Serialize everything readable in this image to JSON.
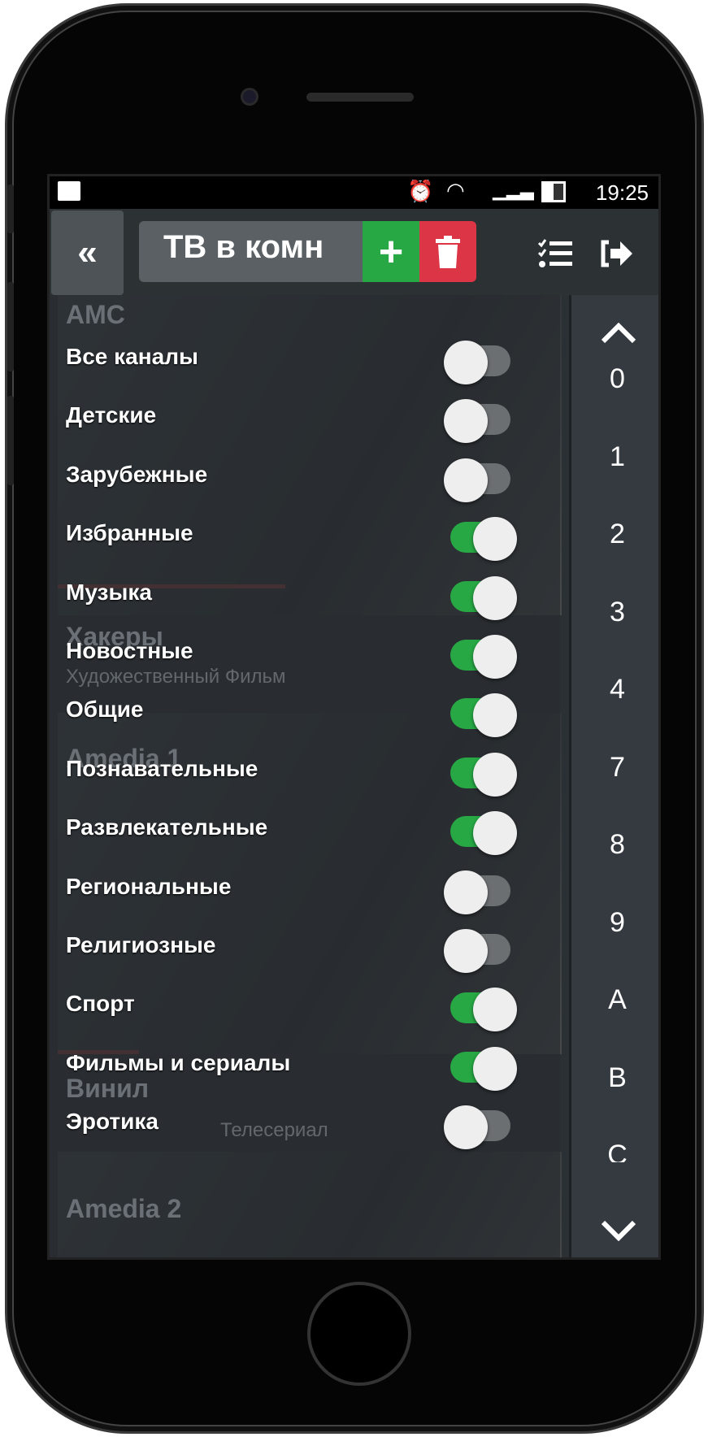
{
  "status_bar": {
    "time": "19:25"
  },
  "toolbar": {
    "back_label": "«",
    "title": "ТВ в комн",
    "add_label": "+"
  },
  "background_cards": [
    {
      "title": "AMC"
    },
    {
      "title": "Хакеры",
      "subtitle": "Художественный Фильм"
    },
    {
      "title": "Amedia 1"
    },
    {
      "title": "Винил",
      "subtitle": "Телесериал"
    },
    {
      "title": "Amedia 2"
    }
  ],
  "categories": [
    {
      "label": "Все каналы",
      "enabled": false
    },
    {
      "label": "Детские",
      "enabled": false
    },
    {
      "label": "Зарубежные",
      "enabled": false
    },
    {
      "label": "Избранные",
      "enabled": true
    },
    {
      "label": "Музыка",
      "enabled": true
    },
    {
      "label": "Новостные",
      "enabled": true
    },
    {
      "label": "Общие",
      "enabled": true
    },
    {
      "label": "Познавательные",
      "enabled": true
    },
    {
      "label": "Развлекательные",
      "enabled": true
    },
    {
      "label": "Региональные",
      "enabled": false
    },
    {
      "label": "Религиозные",
      "enabled": false
    },
    {
      "label": "Спорт",
      "enabled": true
    },
    {
      "label": "Фильмы и сериалы",
      "enabled": true
    },
    {
      "label": "Эротика",
      "enabled": false
    }
  ],
  "index": [
    "0",
    "1",
    "2",
    "3",
    "4",
    "7",
    "8",
    "9",
    "A",
    "B",
    "C"
  ],
  "colors": {
    "accent_green": "#27a844",
    "danger_red": "#dc3545"
  }
}
